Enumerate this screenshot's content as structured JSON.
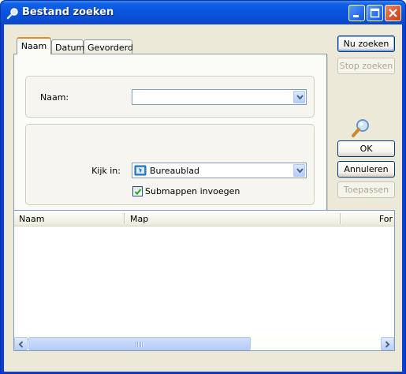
{
  "window": {
    "title": "Bestand zoeken",
    "buttons": {
      "minimize": "minimize",
      "maximize": "maximize",
      "close": "close"
    }
  },
  "tabs": [
    {
      "label": "Naam",
      "active": true
    },
    {
      "label": "Datum",
      "active": false
    },
    {
      "label": "Gevorderd",
      "active": false
    }
  ],
  "name_tab": {
    "name_label": "Naam:",
    "name_value": "",
    "look_in_label": "Kijk in:",
    "look_in_value": "Bureaublad",
    "look_in_icon": "desktop-icon",
    "subfolders_label": "Submappen invoegen",
    "subfolders_checked": true
  },
  "actions": {
    "find_now": "Nu zoeken",
    "stop": "Stop zoeken",
    "ok": "OK",
    "cancel": "Annuleren",
    "apply": "Toepassen"
  },
  "results": {
    "columns": [
      "Naam",
      "Map",
      "For"
    ],
    "rows": []
  },
  "colors": {
    "titlebar": "#0a55e0",
    "dialog_bg": "#ece9d8",
    "tab_accent": "#e68b2c"
  }
}
